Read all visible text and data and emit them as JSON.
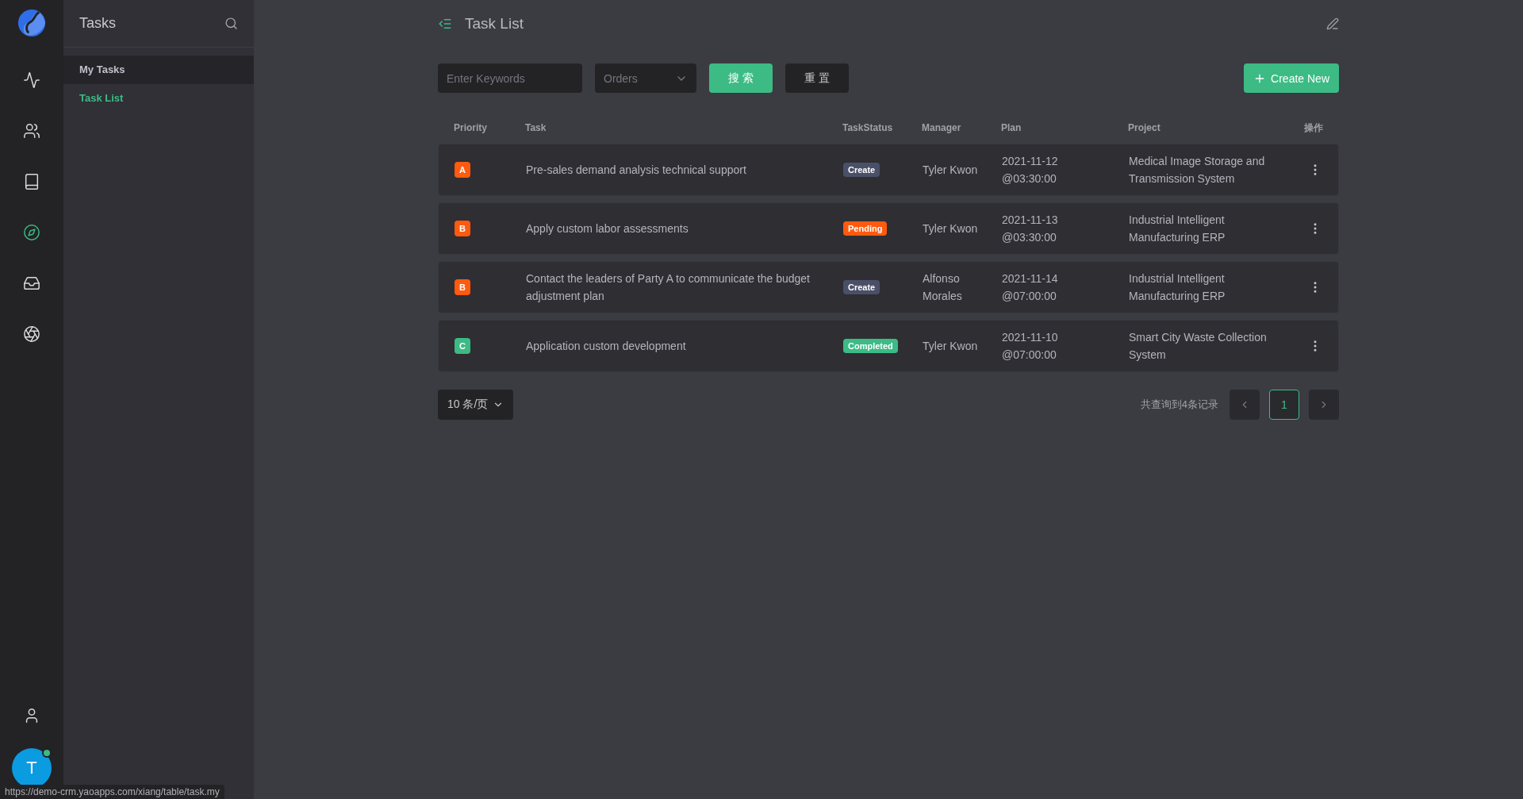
{
  "rail": {
    "items": [
      {
        "selected": false
      },
      {
        "selected": false
      },
      {
        "selected": false
      },
      {
        "selected": true
      },
      {
        "selected": false
      },
      {
        "selected": false
      }
    ],
    "bottom": {
      "avatar": "T",
      "online": true
    }
  },
  "sidebar": {
    "title": "Tasks",
    "items": [
      {
        "label": "My Tasks",
        "kind": "group",
        "selected": false
      },
      {
        "label": "Task List",
        "kind": "link",
        "selected": true
      }
    ]
  },
  "header": {
    "title": "Task List"
  },
  "filters": {
    "keyword_placeholder": "Enter Keywords",
    "select_placeholder": "Orders",
    "search_button": "搜 索",
    "reset_button": "重 置",
    "create_button": "Create New"
  },
  "table": {
    "columns": [
      "Priority",
      "Task",
      "TaskStatus",
      "Manager",
      "Plan",
      "Project",
      "操作"
    ],
    "rows": [
      {
        "priority": {
          "label": "A",
          "color": "#ff5a0f"
        },
        "task": "Pre-sales demand analysis technical support",
        "status": {
          "label": "Create",
          "color": "#4a5068"
        },
        "manager": "Tyler Kwon",
        "plan": [
          "2021-11-12",
          "@03:30:00"
        ],
        "project": "Medical Image Storage and Transmission System"
      },
      {
        "priority": {
          "label": "B",
          "color": "#ff5a0f"
        },
        "task": "Apply custom labor assessments",
        "status": {
          "label": "Pending",
          "color": "#ff5a0f"
        },
        "manager": "Tyler Kwon",
        "plan": [
          "2021-11-13",
          "@03:30:00"
        ],
        "project": "Industrial Intelligent Manufacturing ERP"
      },
      {
        "priority": {
          "label": "B",
          "color": "#ff5a0f"
        },
        "task": "Contact the leaders of Party A to communicate the budget adjustment plan",
        "status": {
          "label": "Create",
          "color": "#4a5068"
        },
        "manager": "Alfonso Morales",
        "plan": [
          "2021-11-14",
          "@07:00:00"
        ],
        "project": "Industrial Intelligent Manufacturing ERP"
      },
      {
        "priority": {
          "label": "C",
          "color": "#3cbb85"
        },
        "task": "Application custom development",
        "status": {
          "label": "Completed",
          "color": "#3cbb85"
        },
        "manager": "Tyler Kwon",
        "plan": [
          "2021-11-10",
          "@07:00:00"
        ],
        "project": "Smart City Waste Collection System"
      }
    ]
  },
  "pagination": {
    "page_size": "10 条/页",
    "total": "共查询到4条记录",
    "pages": [
      {
        "label": "1",
        "selected": true
      }
    ]
  },
  "status_bar": "https://demo-crm.yaoapps.com/xiang/table/task.my"
}
